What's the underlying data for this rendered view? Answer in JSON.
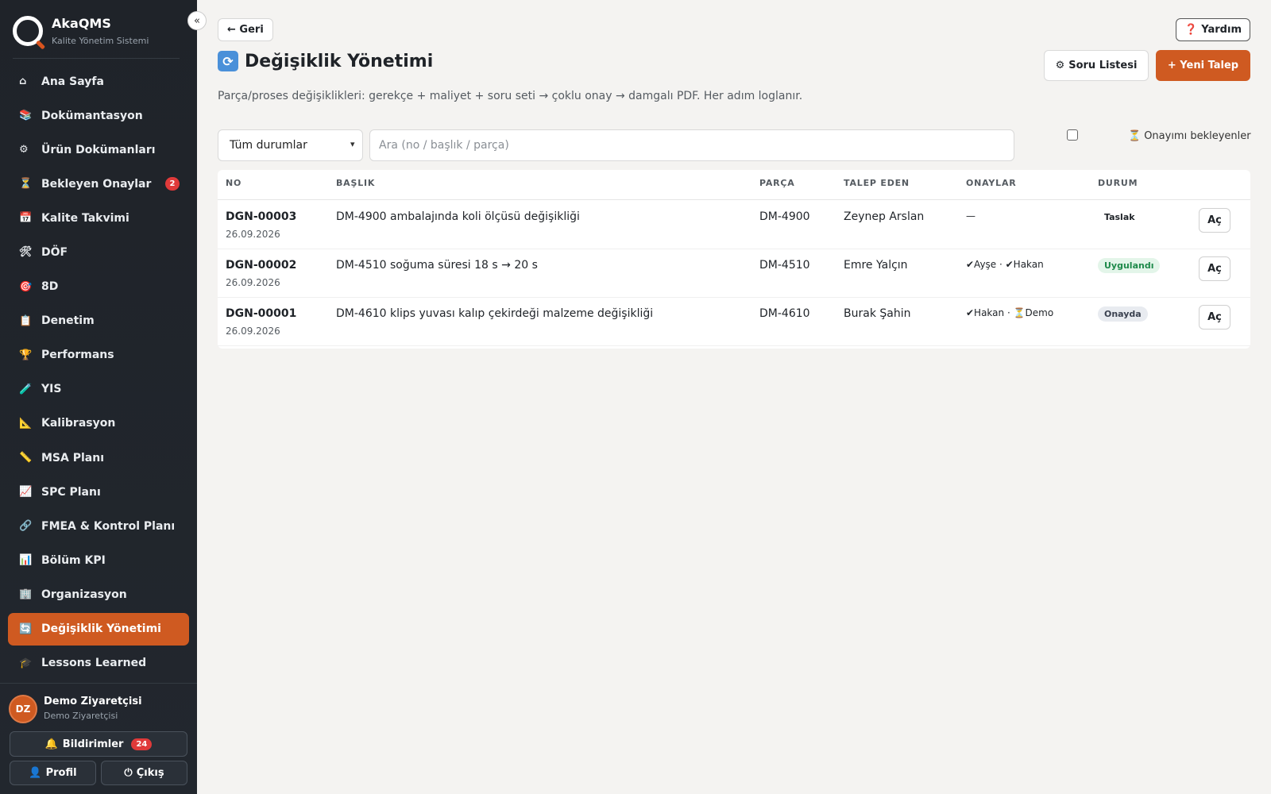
{
  "app": {
    "name": "AkaQMS",
    "subtitle": "Kalite Yönetim Sistemi",
    "collapse_label": "«"
  },
  "sidebar": {
    "items": [
      {
        "label": "Ana Sayfa",
        "icon": "⌂",
        "icon_name": "home-icon"
      },
      {
        "label": "Dokümantasyon",
        "icon": "📚",
        "icon_name": "books-icon"
      },
      {
        "label": "Ürün Dokümanları",
        "icon": "⚙",
        "icon_name": "gear-icon"
      },
      {
        "label": "Bekleyen Onaylar",
        "icon": "⏳",
        "icon_name": "hourglass-icon",
        "badge": "2"
      },
      {
        "label": "Kalite Takvimi",
        "icon": "📅",
        "icon_name": "calendar-icon"
      },
      {
        "label": "DÖF",
        "icon": "🛠",
        "icon_name": "tools-icon"
      },
      {
        "label": "8D",
        "icon": "🎯",
        "icon_name": "target-icon"
      },
      {
        "label": "Denetim",
        "icon": "📋",
        "icon_name": "clipboard-icon"
      },
      {
        "label": "Performans",
        "icon": "🏆",
        "icon_name": "trophy-icon"
      },
      {
        "label": "YIS",
        "icon": "🧪",
        "icon_name": "test-tube-icon"
      },
      {
        "label": "Kalibrasyon",
        "icon": "📐",
        "icon_name": "triangle-ruler-icon"
      },
      {
        "label": "MSA Planı",
        "icon": "📏",
        "icon_name": "ruler-icon"
      },
      {
        "label": "SPC Planı",
        "icon": "📈",
        "icon_name": "chart-up-icon"
      },
      {
        "label": "FMEA & Kontrol Planı",
        "icon": "🔗",
        "icon_name": "link-icon"
      },
      {
        "label": "Bölüm KPI",
        "icon": "📊",
        "icon_name": "bar-chart-icon"
      },
      {
        "label": "Organizasyon",
        "icon": "🏢",
        "icon_name": "building-icon"
      },
      {
        "label": "Değişiklik Yönetimi",
        "icon": "🔄",
        "icon_name": "cycle-icon",
        "active": true
      },
      {
        "label": "Lessons Learned",
        "icon": "🎓",
        "icon_name": "graduation-cap-icon"
      }
    ]
  },
  "user": {
    "initials": "DZ",
    "name": "Demo Ziyaretçisi",
    "role": "Demo Ziyaretçisi",
    "notifications_label": "Bildirimler",
    "notifications_count": "24",
    "profile_label": "Profil",
    "logout_label": "Çıkış"
  },
  "header": {
    "back_label": "← Geri",
    "help_label": "Yardım",
    "title": "Değişiklik Yönetimi",
    "questions_label": "Soru Listesi",
    "new_label": "+ Yeni Talep",
    "subtitle": "Parça/proses değişiklikleri: gerekçe + maliyet + soru seti → çoklu onay → damgalı PDF. Her adım loglanır."
  },
  "filters": {
    "status_selected": "Tüm durumlar",
    "search_placeholder": "Ara (no / başlık / parça)",
    "pending_label": "Onayımı bekleyenler",
    "pending_checked": false
  },
  "table": {
    "columns": [
      "NO",
      "BAŞLIK",
      "PARÇA",
      "TALEP EDEN",
      "ONAYLAR",
      "DURUM"
    ],
    "rows": [
      {
        "no": "DGN-00003",
        "date": "26.09.2026",
        "title": "DM-4900 ambalajında koli ölçüsü değişikliği",
        "part": "DM-4900",
        "requester": "Zeynep Arslan",
        "approvals": "—",
        "status": "Taslak",
        "status_color": "#1f2328",
        "status_bg": "#ffffff",
        "action": "Aç"
      },
      {
        "no": "DGN-00002",
        "date": "26.09.2026",
        "title": "DM-4510 soğuma süresi 18 s → 20 s",
        "part": "DM-4510",
        "requester": "Emre Yalçın",
        "approvals": "✔Ayşe · ✔Hakan",
        "status": "Uygulandı",
        "status_color": "#1e8a4a",
        "status_bg": "#e3f5e9",
        "action": "Aç"
      },
      {
        "no": "DGN-00001",
        "date": "26.09.2026",
        "title": "DM-4610 klips yuvası kalıp çekirdeği malzeme değişikliği",
        "part": "DM-4610",
        "requester": "Burak Şahin",
        "approvals": "✔Hakan · ⏳Demo",
        "status": "Onayda",
        "status_color": "#3b4250",
        "status_bg": "#e8ebf0",
        "action": "Aç"
      }
    ]
  },
  "colors": {
    "accent": "#cf5a21",
    "sidebar_bg": "#1f2329",
    "page_bg": "#f4f3f1",
    "badge_red": "#e03a3a"
  }
}
